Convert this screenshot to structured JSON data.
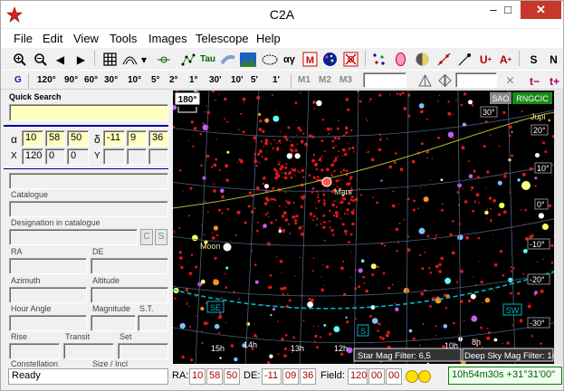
{
  "window": {
    "title": "C2A",
    "minimize": "–",
    "maximize": "□",
    "close": "✕"
  },
  "menu": [
    "File",
    "Edit",
    "View",
    "Tools",
    "Images",
    "Telescope",
    "Help"
  ],
  "toolbar2": {
    "g": "G",
    "fov": [
      "120°",
      "90°",
      "60°",
      "30°",
      "10°",
      "5°",
      "2°",
      "1°",
      "30'",
      "10'",
      "5'",
      "1'"
    ],
    "m": [
      "M1",
      "M2",
      "M3"
    ]
  },
  "quick_search": {
    "label": "Quick Search",
    "value": ""
  },
  "coords": {
    "alpha_label": "α",
    "alpha": [
      "10",
      "58",
      "50"
    ],
    "delta_label": "δ",
    "delta": [
      "-11",
      "9",
      "36"
    ],
    "x_label": "X",
    "x": [
      "120",
      "0",
      "0"
    ],
    "y_label": "Y",
    "y": [
      "",
      "",
      ""
    ]
  },
  "info": {
    "catalogue": "Catalogue",
    "designation": "Designation in catalogue",
    "ra": "RA",
    "de": "DE",
    "azimuth": "Azimuth",
    "altitude": "Altitude",
    "hour_angle": "Hour Angle",
    "magnitude": "Magnitude",
    "st": "S.T.",
    "rise": "Rise",
    "transit": "Transit",
    "set": "Set",
    "constellation": "Constellation",
    "size": "Size / Incl",
    "c_btn": "C",
    "s_btn": "S"
  },
  "status": {
    "ready": "Ready",
    "ra_label": "RA:",
    "ra": [
      "10",
      "58",
      "50"
    ],
    "de_label": "DE:",
    "de": [
      "-11",
      "09",
      "36"
    ],
    "field_label": "Field:",
    "field": [
      "120",
      "00",
      "00"
    ],
    "clock": "10h54m30s  +31°31'00\""
  },
  "map": {
    "fov_badge": "180°",
    "sao": "SAO",
    "ngc": "RNGCIC",
    "labels": {
      "mars": "Mars",
      "moon": "Moon",
      "jupiter": "Jupi",
      "se": "SE",
      "s": "S",
      "sw": "SW",
      "h15": "15h",
      "h14": "14h",
      "h13": "13h",
      "h12": "12h",
      "h10": "10h",
      "h8": "8h",
      "dec30": "30°",
      "dec20": "20°",
      "dec10": "10°",
      "dec0": "0°",
      "decm10": "-10°",
      "decm20": "-20°",
      "decm30": "-30°",
      "h10b": "10h"
    },
    "star_mag_filter": "Star Mag Filter: 6,5",
    "dso_mag_filter": "Deep Sky Mag Filter: 14"
  },
  "colors": {
    "map_bg": "#000000",
    "stars": "#e01818",
    "grid": "#506080",
    "ecliptic": "#b4b432",
    "labels": "#e6e68c"
  }
}
